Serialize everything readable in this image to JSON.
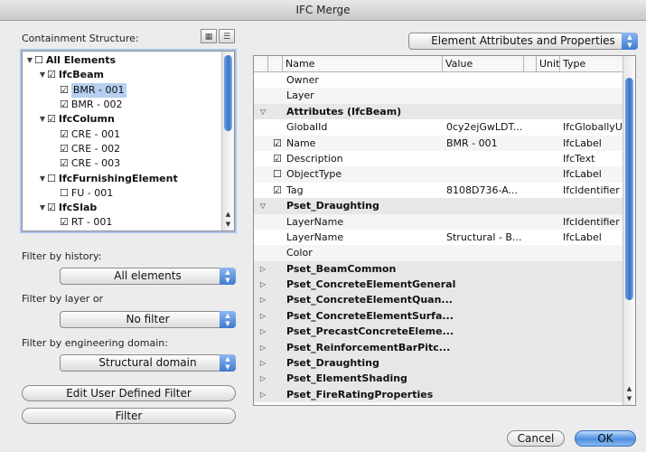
{
  "window": {
    "title": "IFC Merge"
  },
  "left": {
    "containment_label": "Containment Structure:",
    "tree": [
      {
        "text": "All Elements",
        "check": "☐",
        "tri": "▼",
        "indent": 0,
        "bold": true
      },
      {
        "text": "IfcBeam",
        "check": "☑",
        "tri": "▼",
        "indent": 1,
        "bold": true
      },
      {
        "text": "BMR - 001",
        "check": "☑",
        "tri": "",
        "indent": 2,
        "bold": false,
        "selected": true
      },
      {
        "text": "BMR - 002",
        "check": "☑",
        "tri": "",
        "indent": 2,
        "bold": false
      },
      {
        "text": "IfcColumn",
        "check": "☑",
        "tri": "▼",
        "indent": 1,
        "bold": true
      },
      {
        "text": "CRE - 001",
        "check": "☑",
        "tri": "",
        "indent": 2,
        "bold": false
      },
      {
        "text": "CRE - 002",
        "check": "☑",
        "tri": "",
        "indent": 2,
        "bold": false
      },
      {
        "text": "CRE - 003",
        "check": "☑",
        "tri": "",
        "indent": 2,
        "bold": false
      },
      {
        "text": "IfcFurnishingElement",
        "check": "☐",
        "tri": "▼",
        "indent": 1,
        "bold": true
      },
      {
        "text": "FU - 001",
        "check": "☐",
        "tri": "",
        "indent": 2,
        "bold": false
      },
      {
        "text": "IfcSlab",
        "check": "☑",
        "tri": "▼",
        "indent": 1,
        "bold": true
      },
      {
        "text": "RT - 001",
        "check": "☑",
        "tri": "",
        "indent": 2,
        "bold": false
      }
    ],
    "history_label": "Filter by history:",
    "history_value": "All elements",
    "layer_label": "Filter by layer or",
    "layer_value": "No filter",
    "domain_label": "Filter by engineering domain:",
    "domain_value": "Structural domain",
    "edit_filter_label": "Edit User Defined Filter",
    "filter_label": "Filter"
  },
  "right": {
    "view_value": "Element Attributes and Properties",
    "columns": {
      "name": "Name",
      "value": "Value",
      "unit": "Unit",
      "type": "Type"
    },
    "rows": [
      {
        "kind": "item",
        "name": "Owner",
        "check": "",
        "value": "",
        "type": ""
      },
      {
        "kind": "item",
        "name": "Layer",
        "check": "",
        "value": "",
        "type": ""
      },
      {
        "kind": "group",
        "name": "Attributes (IfcBeam)",
        "tri": "▽"
      },
      {
        "kind": "item",
        "name": "GlobalId",
        "check": "",
        "value": "0cy2ejGwLDT...",
        "type": "IfcGloballyU"
      },
      {
        "kind": "item",
        "name": "Name",
        "check": "☑",
        "value": "BMR - 001",
        "type": "IfcLabel"
      },
      {
        "kind": "item",
        "name": "Description",
        "check": "☑",
        "value": "",
        "type": "IfcText"
      },
      {
        "kind": "item",
        "name": "ObjectType",
        "check": "☐",
        "value": "",
        "type": "IfcLabel"
      },
      {
        "kind": "item",
        "name": "Tag",
        "check": "☑",
        "value": "8108D736-A...",
        "type": "IfcIdentifier"
      },
      {
        "kind": "group",
        "name": "Pset_Draughting",
        "tri": "▽"
      },
      {
        "kind": "item",
        "name": "LayerName",
        "check": "",
        "value": "",
        "type": "IfcIdentifier"
      },
      {
        "kind": "item",
        "name": "LayerName",
        "check": "",
        "value": "Structural - B...",
        "type": "IfcLabel"
      },
      {
        "kind": "item",
        "name": "Color",
        "check": "",
        "value": "",
        "type": ""
      },
      {
        "kind": "group",
        "name": "Pset_BeamCommon",
        "tri": "▷"
      },
      {
        "kind": "group",
        "name": "Pset_ConcreteElementGeneral",
        "tri": "▷"
      },
      {
        "kind": "group",
        "name": "Pset_ConcreteElementQuan...",
        "tri": "▷"
      },
      {
        "kind": "group",
        "name": "Pset_ConcreteElementSurfa...",
        "tri": "▷"
      },
      {
        "kind": "group",
        "name": "Pset_PrecastConcreteEleme...",
        "tri": "▷"
      },
      {
        "kind": "group",
        "name": "Pset_ReinforcementBarPitc...",
        "tri": "▷"
      },
      {
        "kind": "group",
        "name": "Pset_Draughting",
        "tri": "▷"
      },
      {
        "kind": "group",
        "name": "Pset_ElementShading",
        "tri": "▷"
      },
      {
        "kind": "group",
        "name": "Pset_FireRatingProperties",
        "tri": "▷"
      }
    ]
  },
  "buttons": {
    "cancel": "Cancel",
    "ok": "OK"
  },
  "colors": {
    "accent": "#4f8fe0",
    "selection": "#b5d0f0"
  }
}
